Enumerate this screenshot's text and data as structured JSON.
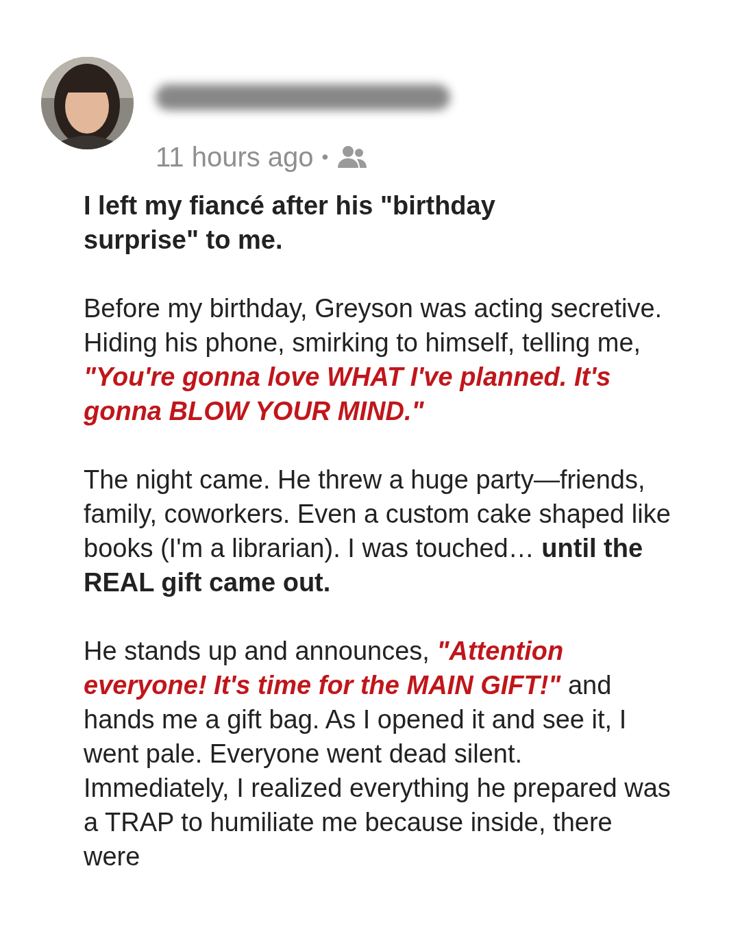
{
  "post": {
    "time": "11 hours ago",
    "separator": "•",
    "title": "I left my fiancé after his \"birthday surprise\" to me.",
    "paragraphs": [
      [
        {
          "kind": "plain",
          "text": "Before my birthday, Greyson was acting secretive. Hiding his phone, smirking to himself, telling me, "
        },
        {
          "kind": "quote",
          "text": "\"You're gonna love WHAT I've planned. It's gonna BLOW YOUR MIND.\""
        }
      ],
      [
        {
          "kind": "plain",
          "text": "The night came. He threw a huge party—friends, family, coworkers. Even a custom cake shaped like books (I'm a librarian). I was touched… "
        },
        {
          "kind": "bold",
          "text": "until the REAL gift came out."
        }
      ],
      [
        {
          "kind": "plain",
          "text": "He stands up and announces, "
        },
        {
          "kind": "quote",
          "text": "\"Attention everyone! It's time for the MAIN GIFT!\""
        },
        {
          "kind": "plain",
          "text": " and hands me a gift bag. As I opened it and see it, I went pale. Everyone went dead silent. Immediately, I realized everything he prepared was a TRAP to humiliate me because inside, there were"
        }
      ]
    ]
  }
}
